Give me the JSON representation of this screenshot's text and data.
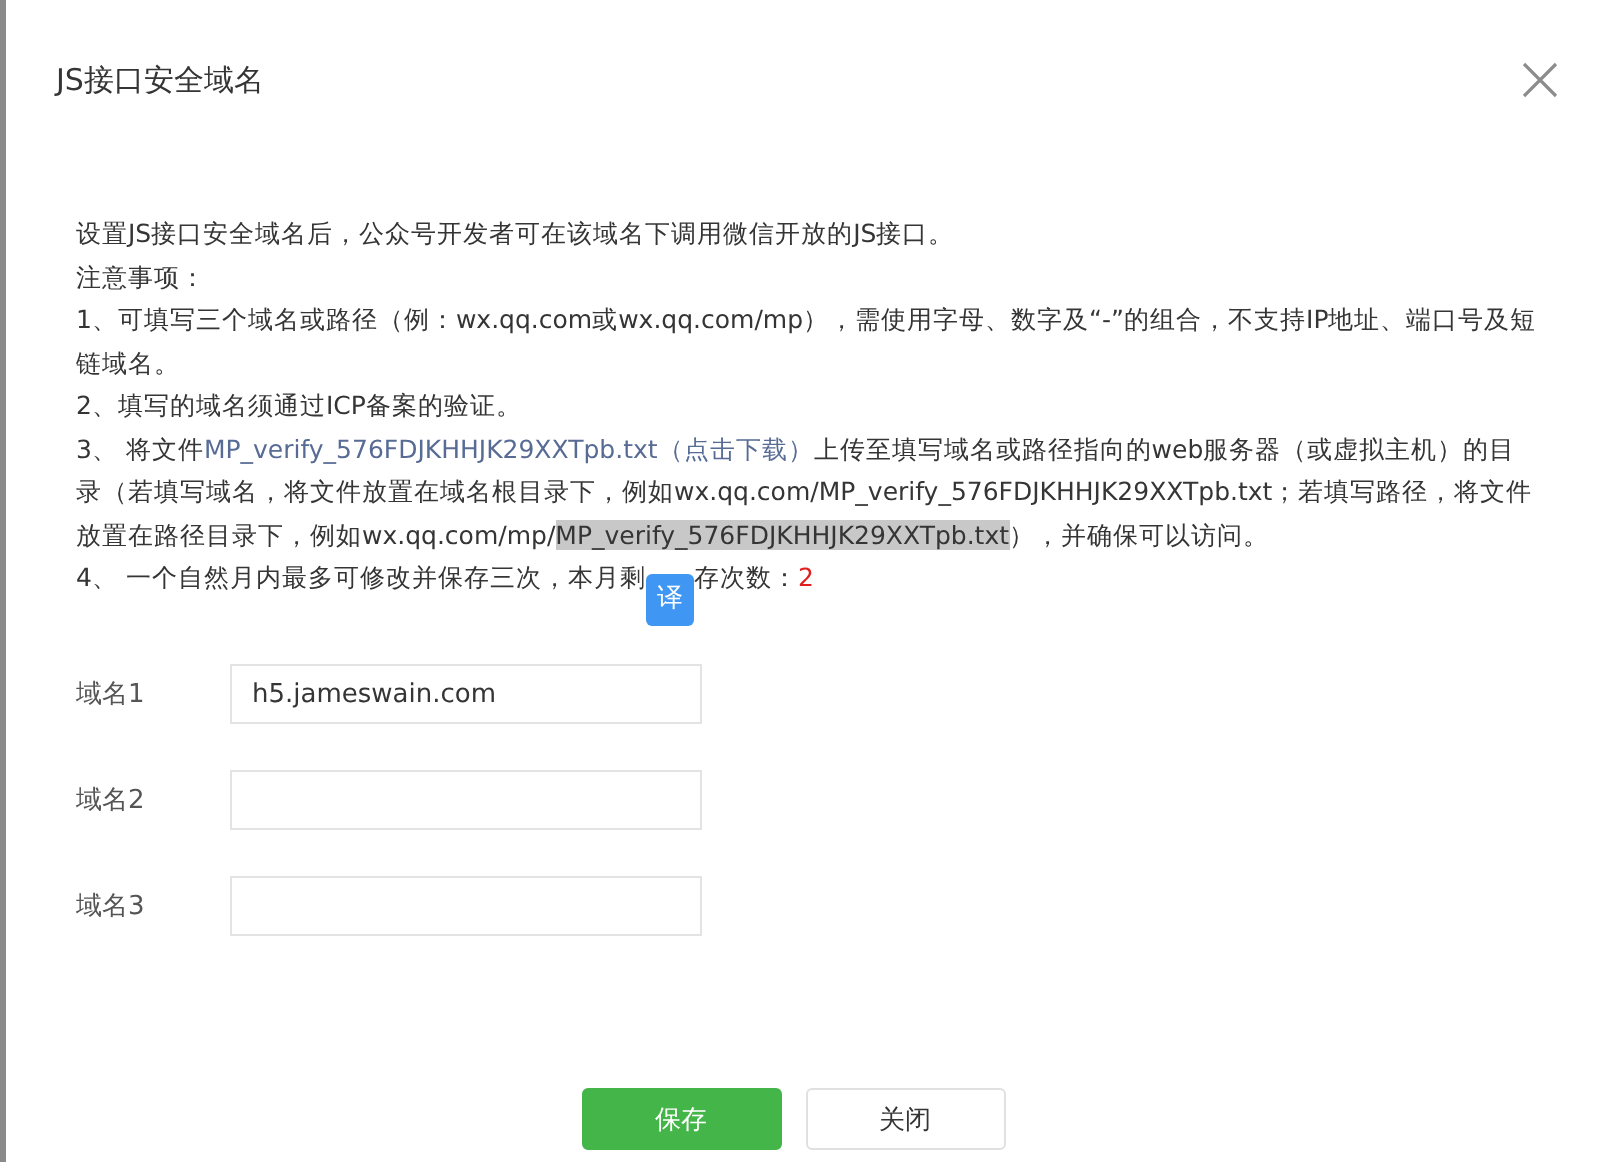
{
  "dialog": {
    "title": "JS接口安全域名"
  },
  "notes": [
    [
      {
        "kind": "plain",
        "text": "设置JS接口安全域名后，公众号开发者可在该域名下调用微信开放的JS接口。"
      }
    ],
    [
      {
        "kind": "plain",
        "text": "注意事项："
      }
    ],
    [
      {
        "kind": "plain",
        "text": "1、可填写三个域名或路径（例：wx.qq.com或wx.qq.com/mp），需使用字母、数字及“-”的组合，不支持IP地址、端口号及短链域名。"
      }
    ],
    [
      {
        "kind": "plain",
        "text": "2、填写的域名须通过ICP备案的验证。"
      }
    ],
    [
      {
        "kind": "plain",
        "text": "3、 将文件"
      },
      {
        "kind": "link",
        "text": "MP_verify_576FDJKHHJK29XXTpb.txt（点击下载）"
      },
      {
        "kind": "plain",
        "text": "上传至填写域名或路径指向的web服务器（或虚拟主机）的目录（若填写域名，将文件放置在域名根目录下，例如wx.qq.com/MP_verify_576FDJKHHJK29XXTpb.txt；若填写路径，将文件放置在路径目录下，例如wx.qq.com/mp/"
      },
      {
        "kind": "highlight",
        "text": "MP_verify_576FDJKHHJK29XXTpb.txt"
      },
      {
        "kind": "plain",
        "text": "），并确保可以访问。"
      }
    ],
    [
      {
        "kind": "plain",
        "text": "4、 一个自然月内最多可修改并保存三次，本月剩"
      },
      {
        "kind": "translate",
        "text": "译"
      },
      {
        "kind": "plain",
        "text": "存次数："
      },
      {
        "kind": "count",
        "text": "2"
      }
    ]
  ],
  "fields": [
    {
      "label": "域名1",
      "value": "h5.jameswain.com"
    },
    {
      "label": "域名2"
    },
    {
      "label": "域名3"
    }
  ],
  "buttons": [
    {
      "label": "保存",
      "kind": "primary"
    },
    {
      "label": "关闭",
      "kind": "default"
    }
  ]
}
